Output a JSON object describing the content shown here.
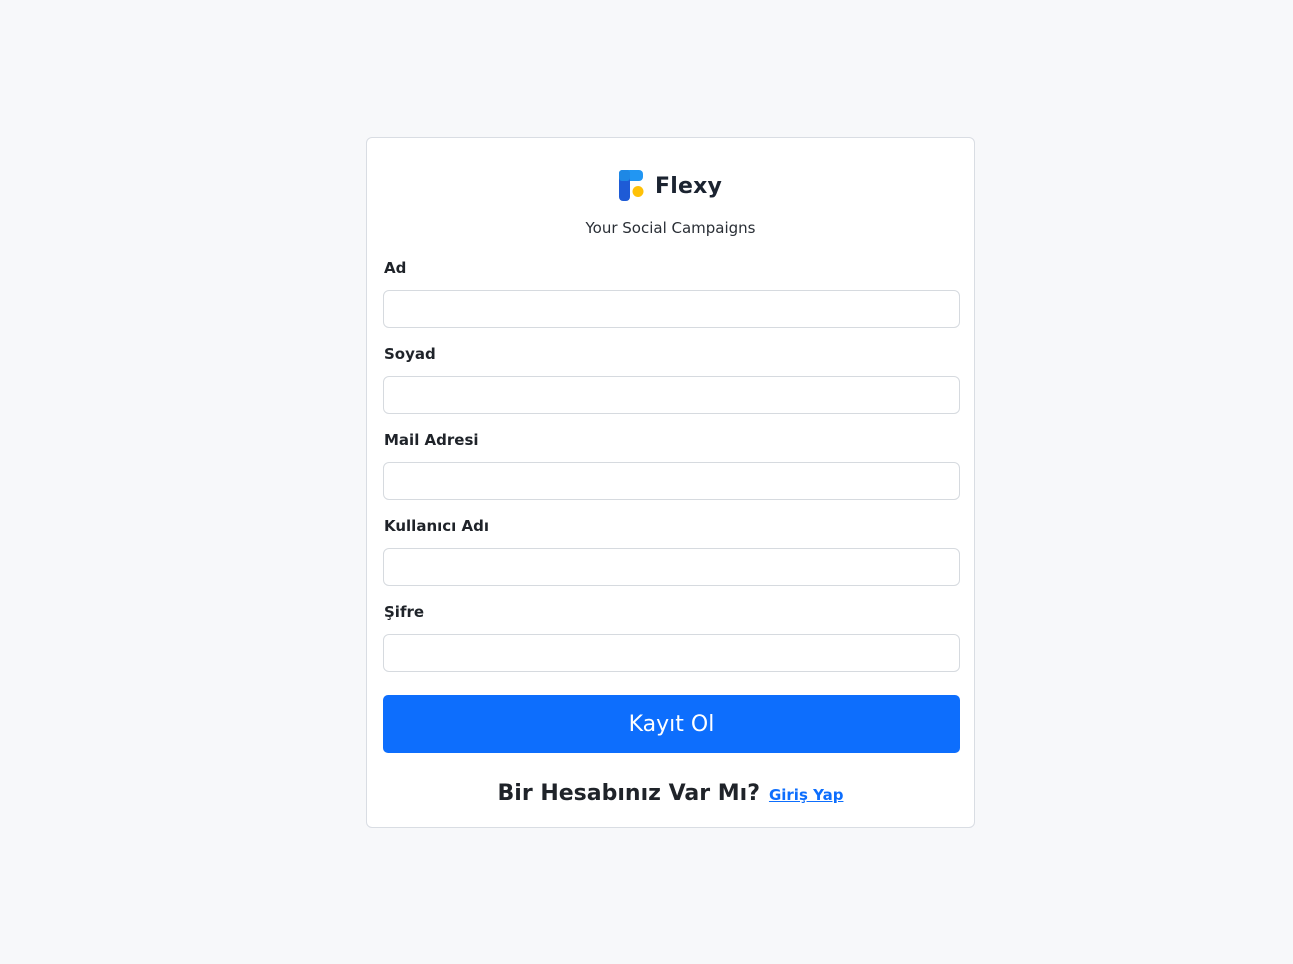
{
  "brand": {
    "name": "Flexy",
    "logo_icon": "flexy-logo-icon",
    "tagline": "Your Social Campaigns"
  },
  "form": {
    "fields": [
      {
        "label": "Ad",
        "value": "",
        "placeholder": ""
      },
      {
        "label": "Soyad",
        "value": "",
        "placeholder": ""
      },
      {
        "label": "Mail Adresi",
        "value": "",
        "placeholder": ""
      },
      {
        "label": "Kullanıcı Adı",
        "value": "",
        "placeholder": ""
      },
      {
        "label": "Şifre",
        "value": "",
        "placeholder": ""
      }
    ],
    "submit_label": "Kayıt Ol"
  },
  "footer": {
    "question": "Bir Hesabınız Var Mı?",
    "link_label": "Giriş Yap"
  },
  "colors": {
    "accent": "#0d6efd",
    "background": "#f7f8fa",
    "logo_blue": "#1e88e5",
    "logo_dark_blue": "#1a3d8f",
    "logo_yellow": "#ffc107"
  }
}
